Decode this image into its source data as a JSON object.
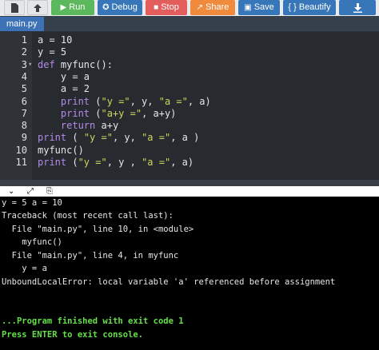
{
  "toolbar": {
    "buttons": [
      {
        "label": "",
        "icon": "file-icon",
        "color": "#e5e6e8"
      },
      {
        "label": "",
        "icon": "upload-icon",
        "color": "#e5e6e8"
      },
      {
        "label": "Run",
        "icon": "play-icon",
        "color": "#5cb85c"
      },
      {
        "label": "Debug",
        "icon": "debug-icon",
        "color": "#3776b8"
      },
      {
        "label": "Stop",
        "icon": "stop-icon",
        "color": "#e35d5d"
      },
      {
        "label": "Share",
        "icon": "share-icon",
        "color": "#f08a3c"
      },
      {
        "label": "Save",
        "icon": "save-icon",
        "color": "#3776b8"
      },
      {
        "label": "{ } Beautify",
        "icon": "",
        "color": "#3776b8"
      },
      {
        "label": "",
        "icon": "download-icon",
        "color": "#3776b8"
      }
    ]
  },
  "file_tab": "main.py",
  "editor": {
    "lines": [
      {
        "num": "1",
        "text": "a = 10"
      },
      {
        "num": "2",
        "text": "y = 5"
      },
      {
        "num": "3",
        "text": "def myfunc():"
      },
      {
        "num": "4",
        "text": "    y = a"
      },
      {
        "num": "5",
        "text": "    a = 2"
      },
      {
        "num": "6",
        "text": "    print (\"y =\", y, \"a =\", a)"
      },
      {
        "num": "7",
        "text": "    print (\"a+y =\", a+y)"
      },
      {
        "num": "8",
        "text": "    return a+y"
      },
      {
        "num": "9",
        "text": "print ( \"y =\", y, \"a =\", a )"
      },
      {
        "num": "10",
        "text": "myfunc()"
      },
      {
        "num": "11",
        "text": "print (\"y =\", y , \"a =\", a)"
      }
    ]
  },
  "output_toolbar": {
    "icons": [
      "chevron-down-icon",
      "expand-icon",
      "copy-icon"
    ]
  },
  "console": {
    "lines": [
      "y = 5 a = 10",
      "Traceback (most recent call last):",
      "  File \"main.py\", line 10, in <module>",
      "    myfunc()",
      "  File \"main.py\", line 4, in myfunc",
      "    y = a",
      "UnboundLocalError: local variable 'a' referenced before assignment"
    ],
    "finish_message": "...Program finished with exit code 1",
    "exit_prompt": "Press ENTER to exit console."
  }
}
